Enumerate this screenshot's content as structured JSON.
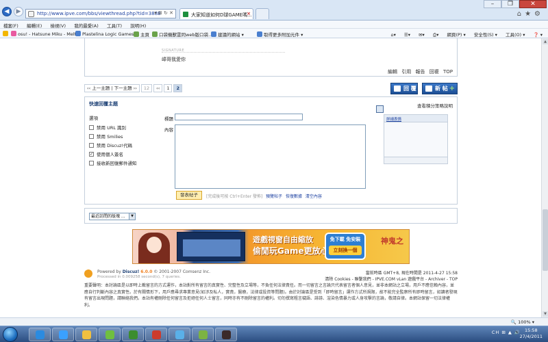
{
  "browser": {
    "url": "http://www.ipve.com/bbs/viewthread.php?tid=3888",
    "tab_title": "大家知道如何D球GAME嗎...",
    "menus": [
      "檔案(F)",
      "編輯(E)",
      "檢視(V)",
      "我的最愛(A)",
      "工具(T)",
      "說明(H)"
    ],
    "favorites": [
      "osu! - Hatsune Miku - Melt",
      "Plastelina Logic Games",
      "主頁",
      "口袋機獸雲同web版口袋...",
      "建議的網站 ▾",
      "取得更多附加元件 ▾"
    ],
    "commands": [
      "網頁(P) ▾",
      "安全性(S) ▾",
      "工具(O) ▾",
      "❓ ▾"
    ],
    "zoom": "100%"
  },
  "post": {
    "sig_label": "SIGNATURE",
    "signature": "嶂哥我愛你",
    "actions": [
      "編輯",
      "引用",
      "報告",
      "回複",
      "TOP"
    ]
  },
  "pagination": {
    "prev": "‹‹ 上一主題",
    "next": "下一主題 ››",
    "total": "12",
    "first": "‹‹",
    "page1": "1",
    "page2": "2"
  },
  "buttons": {
    "reply": "回 覆",
    "new_post": "新 帖"
  },
  "quick_reply": {
    "title": "快速回覆主題",
    "help": "查看積分策略說明",
    "options_title": "選項",
    "options": [
      {
        "label": "禁用 URL 識別",
        "checked": false
      },
      {
        "label": "禁用 Smilies",
        "checked": false
      },
      {
        "label": "禁用 Discuz!代碼",
        "checked": false
      },
      {
        "label": "使用個人簽名",
        "checked": true
      },
      {
        "label": "接收新回復郵件通知",
        "checked": false
      }
    ],
    "title_label": "標題",
    "content_label": "內容",
    "smilies_link": "詳細表情",
    "submit": "發表帖子",
    "hint": "[完成後可按 Ctrl+Enter 發佈]",
    "links": [
      "預覽帖子",
      "恢復數據",
      "清空內容"
    ]
  },
  "jump": {
    "selected": "最近訪問的版塊 ..."
  },
  "banner": {
    "line1": "遊戲視窗自由縮放",
    "line2": "偷閒玩Game更放心!",
    "badge_top": "免下載 免安裝",
    "badge_btn": "立刻換一個",
    "logo": "神鬼之"
  },
  "footer": {
    "powered_by": "Powered by",
    "product": "Discuz!",
    "version": "6.0.0",
    "copyright": "© 2001-2007 Comsenz Inc.",
    "processed": "Processed in 0.009258 second(s), 7 queries.",
    "timezone": "當前時區 GMT+8, 現在時間是 2011-4-27 15:58",
    "links": "清除 Cookies - 聯繫我們 - IPVE.COM vLan 遊戲平台 - Archiver - TOP",
    "disclaimer": "重要聲明：本討論區是以即時上載留言的方式運作，本站對所有留言的真實性、完整性及立場等，不負任何法律責任。而一切留言之言論只代表留言者個人意見，並非本網站之立場，用戶不應信賴內容，並應自行判斷內容之真實性。於有關情形下，用戶應尋求專業意見(如涉及私人，實責，醫療，法律或投資等問題)。由於討論區是受到「即時留言」運作方式所規限，故不能完全監察所有即時留言，如讀者發現有留言出現問題，請聯絡我們。本站有權刪除任何留言及拒絕任何人士留言，同時亦有不刪除留言的權利。切勿撰寫粗言穢語、誹謗、渲染色情暴力或人身攻擊的言論，敬請自律。本網站保留一切法律權利。"
  },
  "taskbar": {
    "tray": "CH ⊞ ▲ 🔊",
    "time": "15:58",
    "date": "27/4/2011"
  }
}
